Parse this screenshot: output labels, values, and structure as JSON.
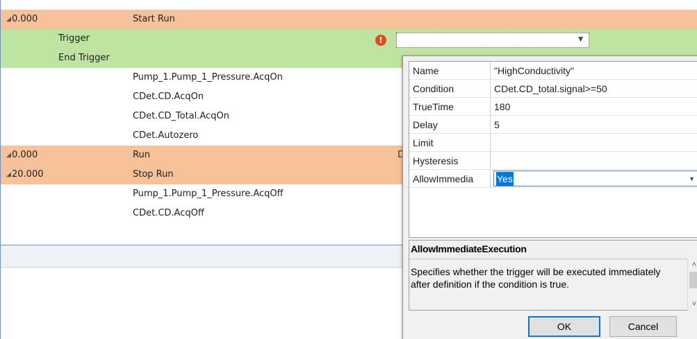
{
  "rows": [
    {
      "expander": "◢",
      "time": "0.000",
      "col1": "",
      "col2": "Start Run"
    },
    {
      "expander": "",
      "time": "",
      "col1": "Trigger",
      "col2": ""
    },
    {
      "expander": "",
      "time": "",
      "col1": "End Trigger",
      "col2": ""
    },
    {
      "expander": "",
      "time": "",
      "col1": "",
      "col2": "Pump_1.Pump_1_Pressure.AcqOn"
    },
    {
      "expander": "",
      "time": "",
      "col1": "",
      "col2": "CDet.CD.AcqOn"
    },
    {
      "expander": "",
      "time": "",
      "col1": "",
      "col2": "CDet.CD_Total.AcqOn"
    },
    {
      "expander": "",
      "time": "",
      "col1": "",
      "col2": "CDet.Autozero"
    },
    {
      "expander": "◢",
      "time": "0.000",
      "col1": "",
      "col2": "Run",
      "partial": "D"
    },
    {
      "expander": "◢",
      "time": "20.000",
      "col1": "",
      "col2": "Stop Run"
    },
    {
      "expander": "",
      "time": "",
      "col1": "",
      "col2": "Pump_1.Pump_1_Pressure.AcqOff"
    },
    {
      "expander": "",
      "time": "",
      "col1": "",
      "col2": "CDet.CD.AcqOff"
    }
  ],
  "trigger_warning_icon": "!",
  "trigger_combo": {
    "arrow": "▼"
  },
  "properties": [
    {
      "name": "Name",
      "value": "\"HighConductivity\""
    },
    {
      "name": "Condition",
      "value": "CDet.CD_total.signal>=50"
    },
    {
      "name": "TrueTime",
      "value": "180"
    },
    {
      "name": "Delay",
      "value": "5"
    },
    {
      "name": "Limit",
      "value": ""
    },
    {
      "name": "Hysteresis",
      "value": ""
    },
    {
      "name": "AllowImmedia",
      "value": "Yes"
    }
  ],
  "description": {
    "title": "AllowImmediateExecution",
    "text": "Specifies whether the trigger will be executed immediately after definition if the condition is true."
  },
  "buttons": {
    "ok": "OK",
    "cancel": "Cancel"
  },
  "colors": {
    "orange_row": "#f7c19a",
    "green_row": "#bfe3a1",
    "selection": "#0078d7"
  }
}
